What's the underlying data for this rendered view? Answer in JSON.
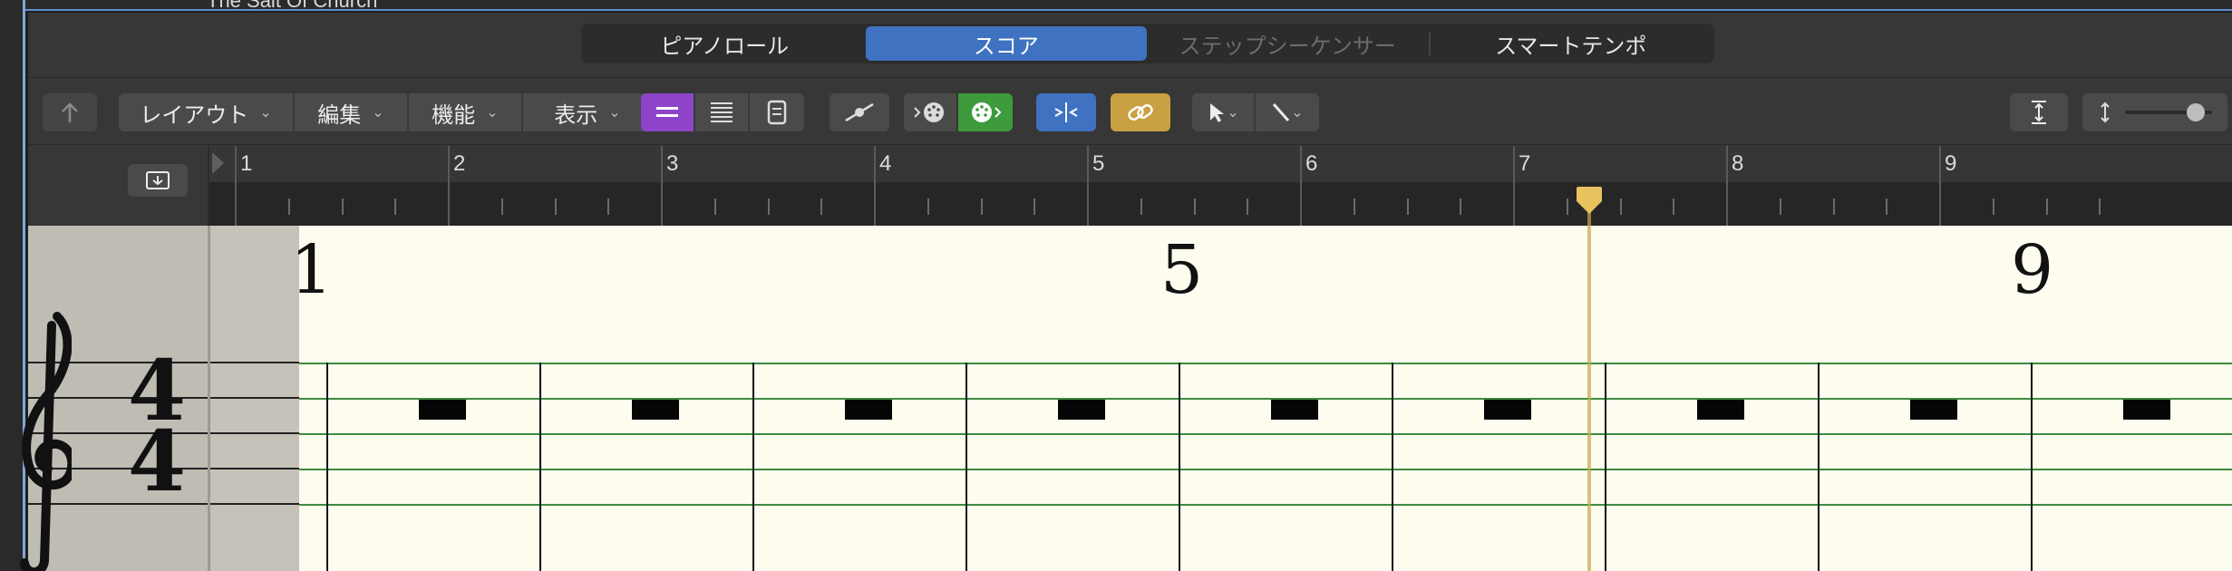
{
  "track_header": {
    "name": "The Salt Of Church"
  },
  "tabs": [
    {
      "label": "ピアノロール",
      "state": "normal"
    },
    {
      "label": "スコア",
      "state": "active"
    },
    {
      "label": "ステップシーケンサー",
      "state": "disabled"
    },
    {
      "label": "スマートテンポ",
      "state": "normal"
    }
  ],
  "toolbar": {
    "menus": [
      {
        "label": "レイアウト"
      },
      {
        "label": "編集"
      },
      {
        "label": "機能"
      },
      {
        "label": "表示"
      }
    ],
    "accent_purple": "#8e44c8",
    "accent_green": "#3d9a3d",
    "accent_blue": "#3f72c0",
    "accent_gold": "#c9a042",
    "zoom_level": 0.9
  },
  "ruler": {
    "bars": [
      "1",
      "2",
      "3",
      "4",
      "5",
      "6",
      "7",
      "8",
      "9"
    ]
  },
  "score": {
    "time_signature": {
      "top": "4",
      "bottom": "4"
    },
    "measure_numbers": [
      "1",
      "5",
      "9"
    ],
    "measure_count": 9,
    "staff_color": "#3d8b3d",
    "page_color": "#fdfcef",
    "playhead_bar": "7"
  }
}
